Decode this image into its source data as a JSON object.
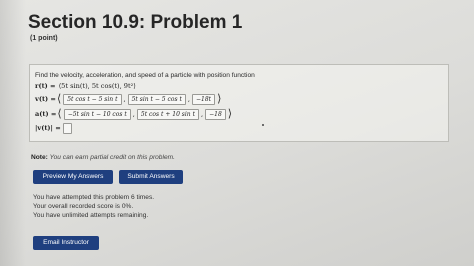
{
  "title": "Section 10.9: Problem 1",
  "points": "(1 point)",
  "problem": {
    "prompt": "Find the velocity, acceleration, and speed of a particle with position function",
    "position": {
      "lhs": "r(t) =",
      "value": "⟨5t sin(t), 5t cos(t), 9t²⟩"
    },
    "velocity": {
      "lhs": "v(t) =",
      "answers": [
        "5t cos t − 5 sin t",
        "5t sin t − 5 cos t",
        "−18t"
      ]
    },
    "acceleration": {
      "lhs": "a(t) =",
      "answers": [
        "−5t sin t − 10 cos t",
        "5t cos t + 10 sin t",
        "−18"
      ]
    },
    "speed": {
      "lhs": "|v(t)| =",
      "answer": ""
    }
  },
  "note": {
    "label": "Note:",
    "text": "You can earn partial credit on this problem."
  },
  "buttons": {
    "preview": "Preview My Answers",
    "submit": "Submit Answers",
    "email": "Email Instructor"
  },
  "status": {
    "attempts": "You have attempted this problem 6 times.",
    "score": "Your overall recorded score is 0%.",
    "remaining": "You have unlimited attempts remaining."
  }
}
